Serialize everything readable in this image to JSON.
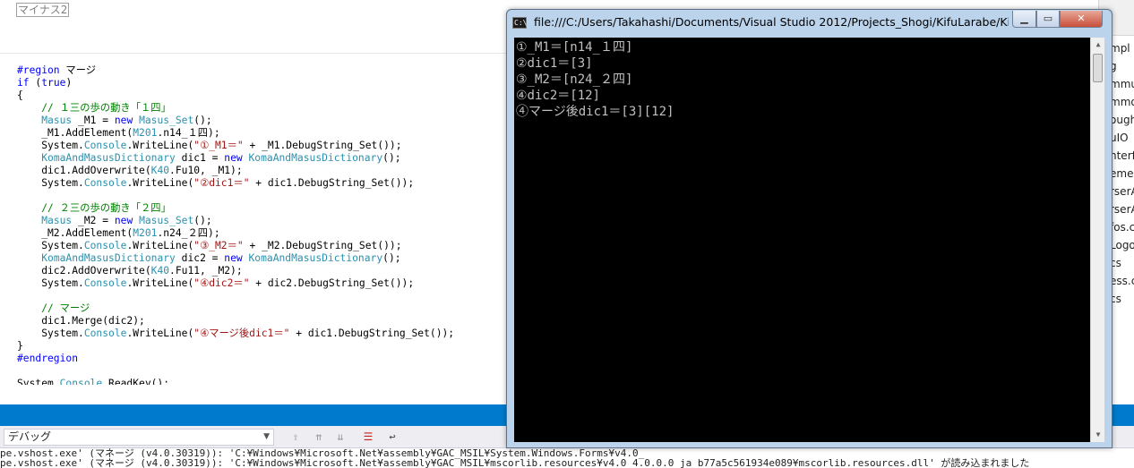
{
  "editor": {
    "boxed_label": "マイナス2",
    "lines": [
      [],
      [],
      [
        {
          "t": "#region",
          "c": "kw"
        },
        {
          "t": " マージ",
          "c": ""
        }
      ],
      [
        {
          "t": "if",
          "c": "kw"
        },
        {
          "t": " (",
          "c": ""
        },
        {
          "t": "true",
          "c": "kw"
        },
        {
          "t": ")",
          "c": ""
        }
      ],
      [
        {
          "t": "{",
          "c": ""
        }
      ],
      [
        {
          "t": "    // １三の歩の動き「１四」",
          "c": "cm"
        }
      ],
      [
        {
          "t": "    ",
          "c": ""
        },
        {
          "t": "Masus",
          "c": "ty"
        },
        {
          "t": " _M1 = ",
          "c": ""
        },
        {
          "t": "new",
          "c": "kw"
        },
        {
          "t": " ",
          "c": ""
        },
        {
          "t": "Masus_Set",
          "c": "ty"
        },
        {
          "t": "();",
          "c": ""
        }
      ],
      [
        {
          "t": "    _M1.AddElement(",
          "c": ""
        },
        {
          "t": "M201",
          "c": "ty"
        },
        {
          "t": ".n14_１四);",
          "c": ""
        }
      ],
      [
        {
          "t": "    System.",
          "c": ""
        },
        {
          "t": "Console",
          "c": "ty"
        },
        {
          "t": ".WriteLine(",
          "c": ""
        },
        {
          "t": "\"①_M1＝\"",
          "c": "st"
        },
        {
          "t": " + _M1.DebugString_Set());",
          "c": ""
        }
      ],
      [
        {
          "t": "    ",
          "c": ""
        },
        {
          "t": "KomaAndMasusDictionary",
          "c": "ty"
        },
        {
          "t": " dic1 = ",
          "c": ""
        },
        {
          "t": "new",
          "c": "kw"
        },
        {
          "t": " ",
          "c": ""
        },
        {
          "t": "KomaAndMasusDictionary",
          "c": "ty"
        },
        {
          "t": "();",
          "c": ""
        }
      ],
      [
        {
          "t": "    dic1.AddOverwrite(",
          "c": ""
        },
        {
          "t": "K40",
          "c": "ty"
        },
        {
          "t": ".Fu10, _M1);",
          "c": ""
        }
      ],
      [
        {
          "t": "    System.",
          "c": ""
        },
        {
          "t": "Console",
          "c": "ty"
        },
        {
          "t": ".WriteLine(",
          "c": ""
        },
        {
          "t": "\"②dic1＝\"",
          "c": "st"
        },
        {
          "t": " + dic1.DebugString_Set());",
          "c": ""
        }
      ],
      [],
      [
        {
          "t": "    // ２三の歩の動き「２四」",
          "c": "cm"
        }
      ],
      [
        {
          "t": "    ",
          "c": ""
        },
        {
          "t": "Masus",
          "c": "ty"
        },
        {
          "t": " _M2 = ",
          "c": ""
        },
        {
          "t": "new",
          "c": "kw"
        },
        {
          "t": " ",
          "c": ""
        },
        {
          "t": "Masus_Set",
          "c": "ty"
        },
        {
          "t": "();",
          "c": ""
        }
      ],
      [
        {
          "t": "    _M2.AddElement(",
          "c": ""
        },
        {
          "t": "M201",
          "c": "ty"
        },
        {
          "t": ".n24_２四);",
          "c": ""
        }
      ],
      [
        {
          "t": "    System.",
          "c": ""
        },
        {
          "t": "Console",
          "c": "ty"
        },
        {
          "t": ".WriteLine(",
          "c": ""
        },
        {
          "t": "\"③_M2＝\"",
          "c": "st"
        },
        {
          "t": " + _M2.DebugString_Set());",
          "c": ""
        }
      ],
      [
        {
          "t": "    ",
          "c": ""
        },
        {
          "t": "KomaAndMasusDictionary",
          "c": "ty"
        },
        {
          "t": " dic2 = ",
          "c": ""
        },
        {
          "t": "new",
          "c": "kw"
        },
        {
          "t": " ",
          "c": ""
        },
        {
          "t": "KomaAndMasusDictionary",
          "c": "ty"
        },
        {
          "t": "();",
          "c": ""
        }
      ],
      [
        {
          "t": "    dic2.AddOverwrite(",
          "c": ""
        },
        {
          "t": "K40",
          "c": "ty"
        },
        {
          "t": ".Fu11, _M2);",
          "c": ""
        }
      ],
      [
        {
          "t": "    System.",
          "c": ""
        },
        {
          "t": "Console",
          "c": "ty"
        },
        {
          "t": ".WriteLine(",
          "c": ""
        },
        {
          "t": "\"④dic2＝\"",
          "c": "st"
        },
        {
          "t": " + dic2.DebugString_Set());",
          "c": ""
        }
      ],
      [],
      [
        {
          "t": "    // マージ",
          "c": "cm"
        }
      ],
      [
        {
          "t": "    dic1.Merge(dic2);",
          "c": ""
        }
      ],
      [
        {
          "t": "    System.",
          "c": ""
        },
        {
          "t": "Console",
          "c": "ty"
        },
        {
          "t": ".WriteLine(",
          "c": ""
        },
        {
          "t": "\"④マージ後dic1＝\"",
          "c": "st"
        },
        {
          "t": " + dic1.DebugString_Set());",
          "c": ""
        }
      ],
      [
        {
          "t": "}",
          "c": ""
        }
      ],
      [
        {
          "t": "#endregion",
          "c": "kw"
        }
      ],
      [],
      [
        {
          "t": "System.",
          "c": ""
        },
        {
          "t": "Console",
          "c": "ty"
        },
        {
          "t": ".ReadKey();",
          "c": ""
        }
      ],
      [],
      [
        {
          "t": "////",
          "c": "cm"
        }
      ]
    ]
  },
  "solution_explorer": {
    "items": [
      "mpl",
      "g",
      "mmu",
      "mmo",
      "ough",
      "uIO",
      "nterf",
      "eme",
      "rserA",
      "rserA",
      "fos.c",
      "Logo",
      "cs",
      "ess.c",
      "cs"
    ]
  },
  "output_panel": {
    "source_dropdown": "デバッグ",
    "lines": [
      "pe.vshost.exe' (マネージ (v4.0.30319)): 'C:¥Windows¥Microsoft.Net¥assembly¥GAC_MSIL¥System.Windows.Forms¥v4.0_",
      "pe.vshost.exe' (マネージ (v4.0.30319)): 'C:¥Windows¥Microsoft.Net¥assembly¥GAC_MSIL¥mscorlib.resources¥v4.0_4.0.0.0_ja_b77a5c561934e089¥mscorlib.resources.dll' が読み込まれました"
    ]
  },
  "console": {
    "title": "file:///C:/Users/Takahashi/Documents/Visual Studio 2012/Projects_Shogi/KifuLarabe/KifuLarabe/bin/Debug/Test.exe",
    "output": [
      "①_M1＝[n14_１四]",
      "②dic1＝[3]",
      "③_M2＝[n24_２四]",
      "④dic2＝[12]",
      "④マージ後dic1＝[3][12]"
    ]
  },
  "colors": {
    "keyword": "#0000ff",
    "comment": "#008000",
    "type": "#2b91af",
    "string": "#a31515",
    "accent_blue": "#007acc",
    "console_bg": "#000000",
    "console_text": "#c0c0c0"
  }
}
